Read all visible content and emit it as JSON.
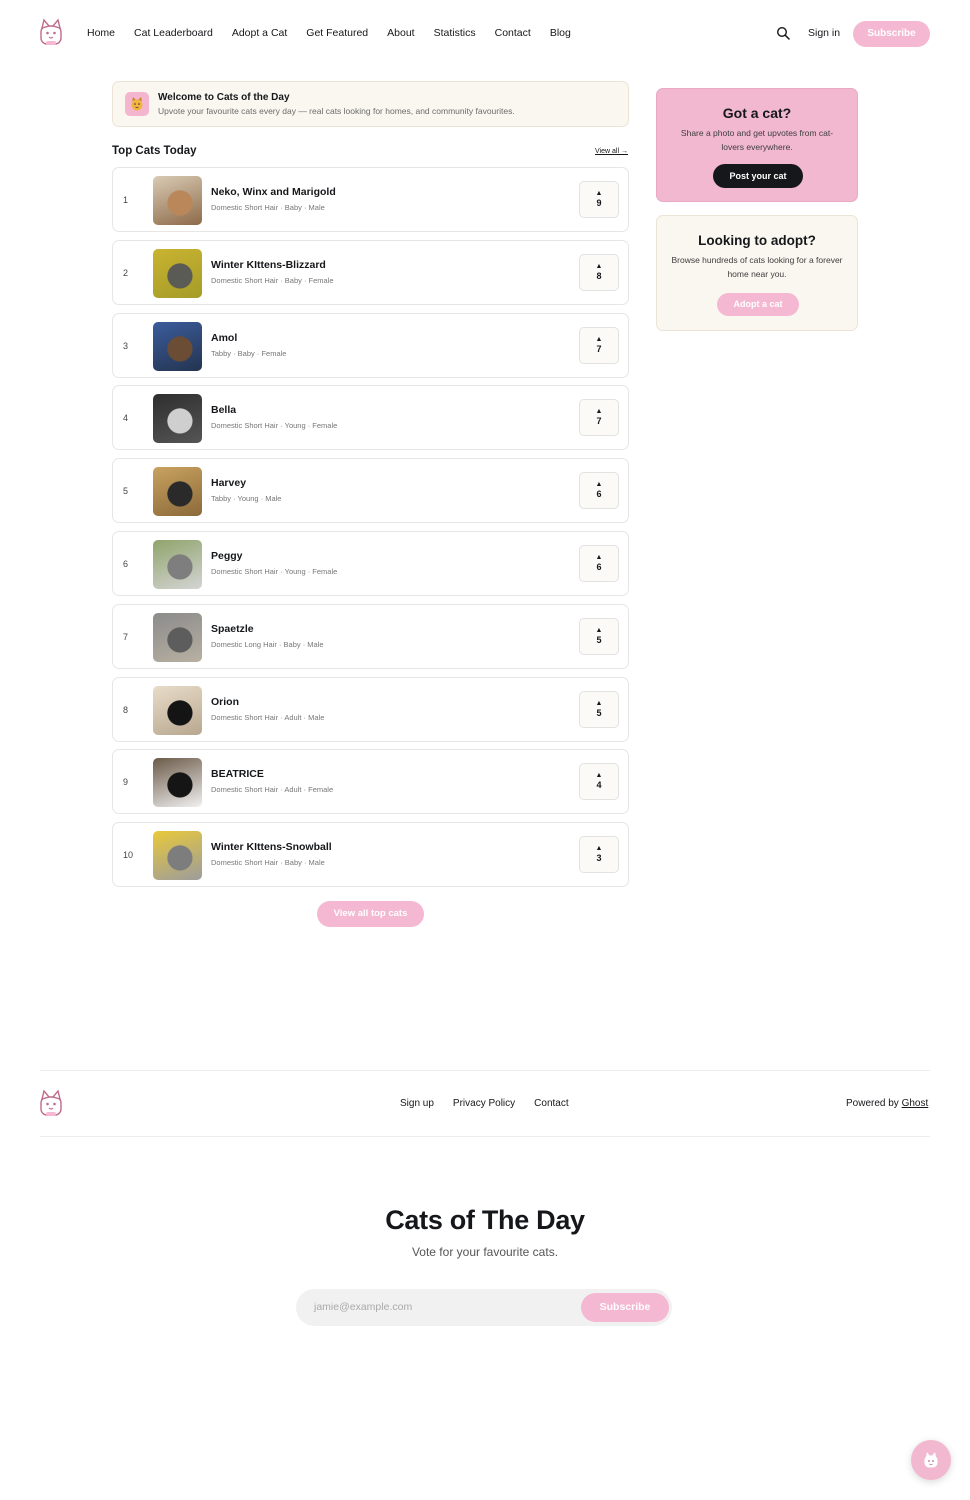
{
  "header": {
    "nav": [
      "Home",
      "Cat Leaderboard",
      "Adopt a Cat",
      "Get Featured",
      "About",
      "Statistics",
      "Contact",
      "Blog"
    ],
    "signin_label": "Sign in",
    "subscribe_label": "Subscribe"
  },
  "welcome": {
    "icon": "cat-face-icon",
    "title": "Welcome to Cats of the Day",
    "subtitle": "Upvote your favourite cats every day — real cats looking for homes, and community favourites."
  },
  "top_cats": {
    "title": "Top Cats Today",
    "view_all": "View all →",
    "items": [
      {
        "rank": "1",
        "name": "Neko, Winx and Marigold",
        "meta": "Domestic Short Hair · Baby · Male",
        "votes": "9"
      },
      {
        "rank": "2",
        "name": "Winter KIttens-Blizzard",
        "meta": "Domestic Short Hair · Baby · Female",
        "votes": "8"
      },
      {
        "rank": "3",
        "name": "Amol",
        "meta": "Tabby · Baby · Female",
        "votes": "7"
      },
      {
        "rank": "4",
        "name": "Bella",
        "meta": "Domestic Short Hair · Young · Female",
        "votes": "7"
      },
      {
        "rank": "5",
        "name": "Harvey",
        "meta": "Tabby · Young · Male",
        "votes": "6"
      },
      {
        "rank": "6",
        "name": "Peggy",
        "meta": "Domestic Short Hair · Young · Female",
        "votes": "6"
      },
      {
        "rank": "7",
        "name": "Spaetzle",
        "meta": "Domestic Long Hair · Baby · Male",
        "votes": "5"
      },
      {
        "rank": "8",
        "name": "Orion",
        "meta": "Domestic Short Hair · Adult · Male",
        "votes": "5"
      },
      {
        "rank": "9",
        "name": "BEATRICE",
        "meta": "Domestic Short Hair · Adult · Female",
        "votes": "4"
      },
      {
        "rank": "10",
        "name": "Winter KIttens-Snowball",
        "meta": "Domestic Short Hair · Baby · Male",
        "votes": "3"
      }
    ],
    "view_all_button": "View all top cats"
  },
  "sidebar": {
    "got_cat": {
      "title": "Got a cat?",
      "text": "Share a photo and get upvotes from cat-lovers everywhere.",
      "button": "Post your cat"
    },
    "adopt": {
      "title": "Looking to adopt?",
      "text": "Browse hundreds of cats looking for a forever home near you.",
      "button": "Adopt a cat"
    }
  },
  "footer": {
    "links": [
      "Sign up",
      "Privacy Policy",
      "Contact"
    ],
    "powered_prefix": "Powered by",
    "powered_link": "Ghost"
  },
  "newsletter": {
    "title": "Cats of The Day",
    "subtitle": "Vote for your favourite cats.",
    "placeholder": "jamie@example.com",
    "button": "Subscribe"
  },
  "colors": {
    "accent_pink": "#f5b8d2",
    "dark": "#15171a",
    "cream": "#faf7f0"
  }
}
